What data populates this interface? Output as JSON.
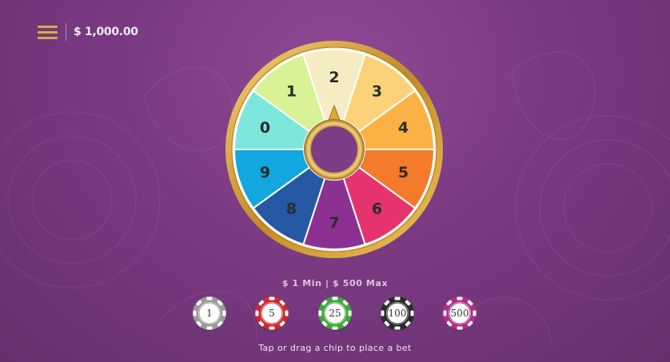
{
  "header": {
    "menu_icon": "hamburger-menu-icon",
    "balance": "$ 1,000.00"
  },
  "wheel": {
    "segments": [
      {
        "label": "2",
        "color": "#f5ecc4"
      },
      {
        "label": "3",
        "color": "#fbd27a"
      },
      {
        "label": "4",
        "color": "#fbb244"
      },
      {
        "label": "5",
        "color": "#f47a2c"
      },
      {
        "label": "6",
        "color": "#e6336d"
      },
      {
        "label": "7",
        "color": "#8c3193"
      },
      {
        "label": "8",
        "color": "#2659a3"
      },
      {
        "label": "9",
        "color": "#12a8df"
      },
      {
        "label": "0",
        "color": "#7ce6dd"
      },
      {
        "label": "1",
        "color": "#d8f296"
      }
    ],
    "rim_color": "#c9962a",
    "pointer_color": "#d8aa3e"
  },
  "limits": "$ 1 Min | $ 500 Max",
  "chips": [
    {
      "value": "1",
      "color": "#9a9a9a"
    },
    {
      "value": "5",
      "color": "#cc2a2f"
    },
    {
      "value": "25",
      "color": "#3da63d"
    },
    {
      "value": "100",
      "color": "#2a2a2a"
    },
    {
      "value": "500",
      "color": "#b02d89"
    }
  ],
  "hint": "Tap or drag a chip to place a bet"
}
